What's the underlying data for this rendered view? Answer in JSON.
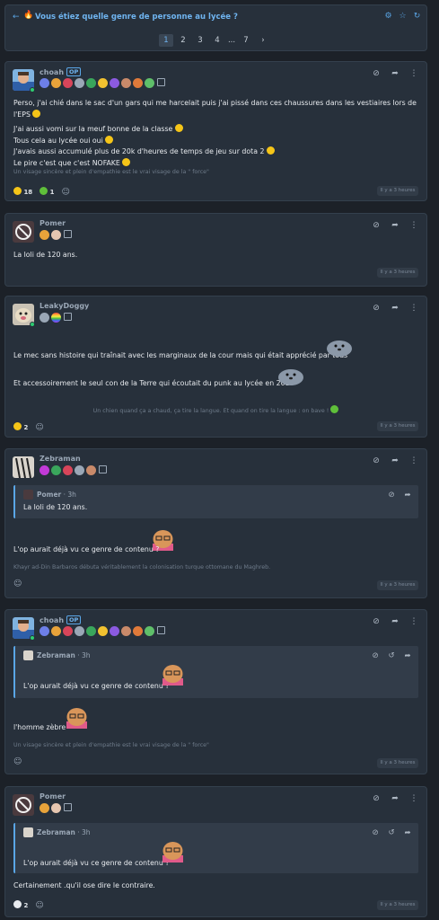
{
  "topic": {
    "title": "Vous étiez quelle genre de personne au lycée ?",
    "pages": [
      "1",
      "2",
      "3",
      "4",
      "...",
      "7",
      "›"
    ]
  },
  "posts": [
    {
      "author": "choah",
      "op_badge": "OP",
      "body": [
        "Perso, j'ai chié dans le sac d'un gars qui me harcelait puis j'ai pissé dans ces chaussures dans les vestiaires lors de l'EPS",
        "J'ai aussi vomi sur la meuf bonne de la classe",
        "Tous cela au lycée oui oui",
        "J'avais aussi accumulé plus de 20k d'heures de temps de jeu sur dota 2",
        "Le pire c'est que c'est NOFAKE"
      ],
      "signature": "Un visage sincère et plein d'empathie est le vrai visage de la \" force\"",
      "reactions": [
        {
          "icon": "laughing-emoji",
          "count": "18"
        },
        {
          "icon": "alien-emoji",
          "count": "1"
        }
      ],
      "time": "Il y a 3 heures"
    },
    {
      "author": "Pomer",
      "body": [
        "La loli de 120 ans."
      ],
      "time": "Il y a 3 heures"
    },
    {
      "author": "LeakyDoggy",
      "body": [
        "Le mec sans histoire qui traînait avec les marginaux de la cour mais qui était apprécié par tous",
        "Et accessoirement le seul con de la Terre qui écoutait du punk au lycée en 2019"
      ],
      "signature": "Un chien quand ça a chaud, ça tire la langue. Et quand on tire la langue : on bave !",
      "reactions": [
        {
          "icon": "thumbs-up-emoji",
          "count": "2"
        }
      ],
      "time": "Il y a 3 heures"
    },
    {
      "author": "Zebraman",
      "quote": {
        "author": "Pomer",
        "time": "3h",
        "text": "La loli de 120 ans."
      },
      "body": [
        "L'op aurait déjà vu ce genre de contenu ?"
      ],
      "signature": "Khayr ad-Din Barbaros débuta véritablement la colonisation turque ottomane du Maghreb.",
      "time": "Il y a 3 heures"
    },
    {
      "author": "choah",
      "op_badge": "OP",
      "quote": {
        "author": "Zebraman",
        "time": "3h",
        "text": "L'op aurait déjà vu ce genre de contenu ?"
      },
      "body": [
        "l'homme zèbre"
      ],
      "signature": "Un visage sincère et plein d'empathie est le vrai visage de la \" force\"",
      "time": "Il y a 3 heures"
    },
    {
      "author": "Pomer",
      "quote": {
        "author": "Zebraman",
        "time": "3h",
        "text": "L'op aurait déjà vu ce genre de contenu ?"
      },
      "body": [
        "Certainement .qu'il ose dire le contraire."
      ],
      "reactions": [
        {
          "icon": "skull-emoji",
          "count": "2"
        }
      ],
      "time": "Il y a 3 heures"
    }
  ],
  "sep": " · ",
  "colors": {
    "accent": "#5aa6e6",
    "card": "#27303b",
    "background": "#1c2128"
  }
}
